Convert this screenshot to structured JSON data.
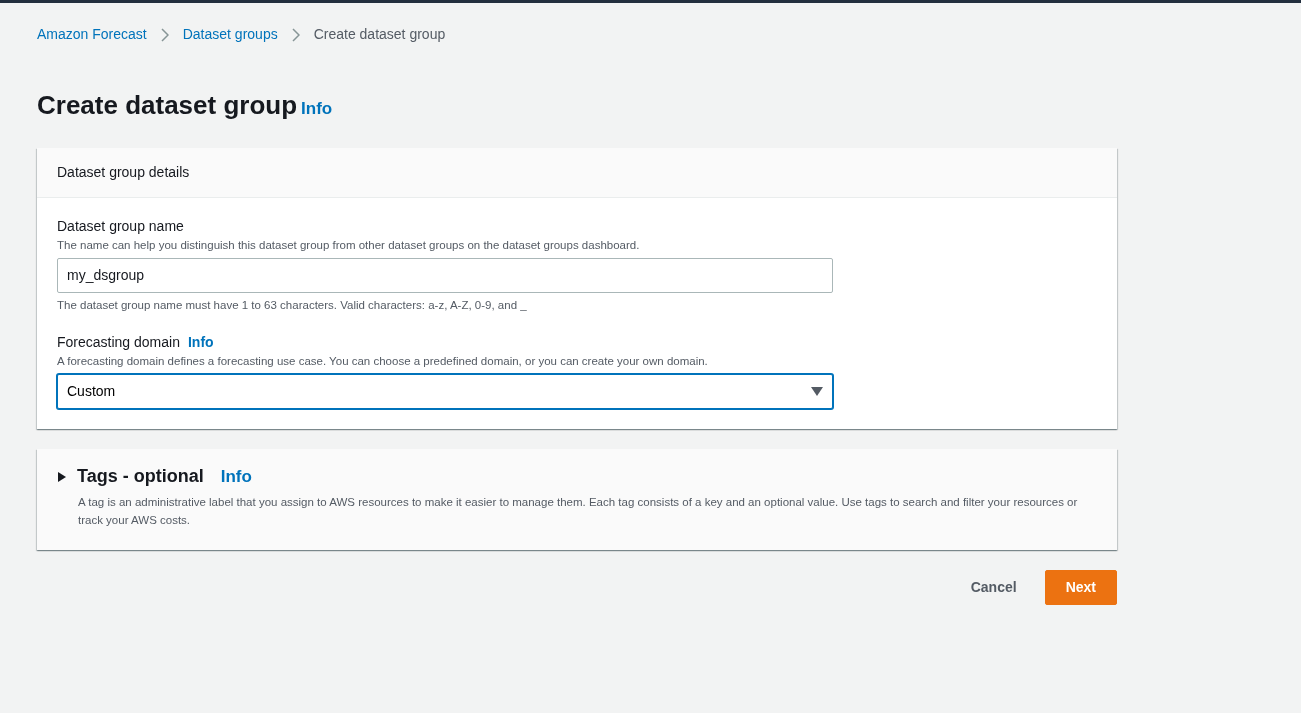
{
  "breadcrumbs": [
    {
      "label": "Amazon Forecast",
      "current": false
    },
    {
      "label": "Dataset groups",
      "current": false
    },
    {
      "label": "Create dataset group",
      "current": true
    }
  ],
  "page": {
    "title": "Create dataset group",
    "info": "Info"
  },
  "details": {
    "header": "Dataset group details",
    "name_field": {
      "label": "Dataset group name",
      "description": "The name can help you distinguish this dataset group from other dataset groups on the dataset groups dashboard.",
      "value": "my_dsgroup",
      "constraint": "The dataset group name must have 1 to 63 characters. Valid characters: a-z, A-Z, 0-9, and _"
    },
    "domain_field": {
      "label": "Forecasting domain",
      "info": "Info",
      "description": "A forecasting domain defines a forecasting use case. You can choose a predefined domain, or you can create your own domain.",
      "value": "Custom",
      "focused": true
    }
  },
  "tags": {
    "title": "Tags - optional",
    "info": "Info",
    "expanded": false,
    "description": "A tag is an administrative label that you assign to AWS resources to make it easier to manage them. Each tag consists of a key and an optional value. Use tags to search and filter your resources or track your AWS costs."
  },
  "buttons": [
    {
      "label": "Cancel",
      "kind": "link"
    },
    {
      "label": "Next",
      "kind": "primary"
    }
  ]
}
